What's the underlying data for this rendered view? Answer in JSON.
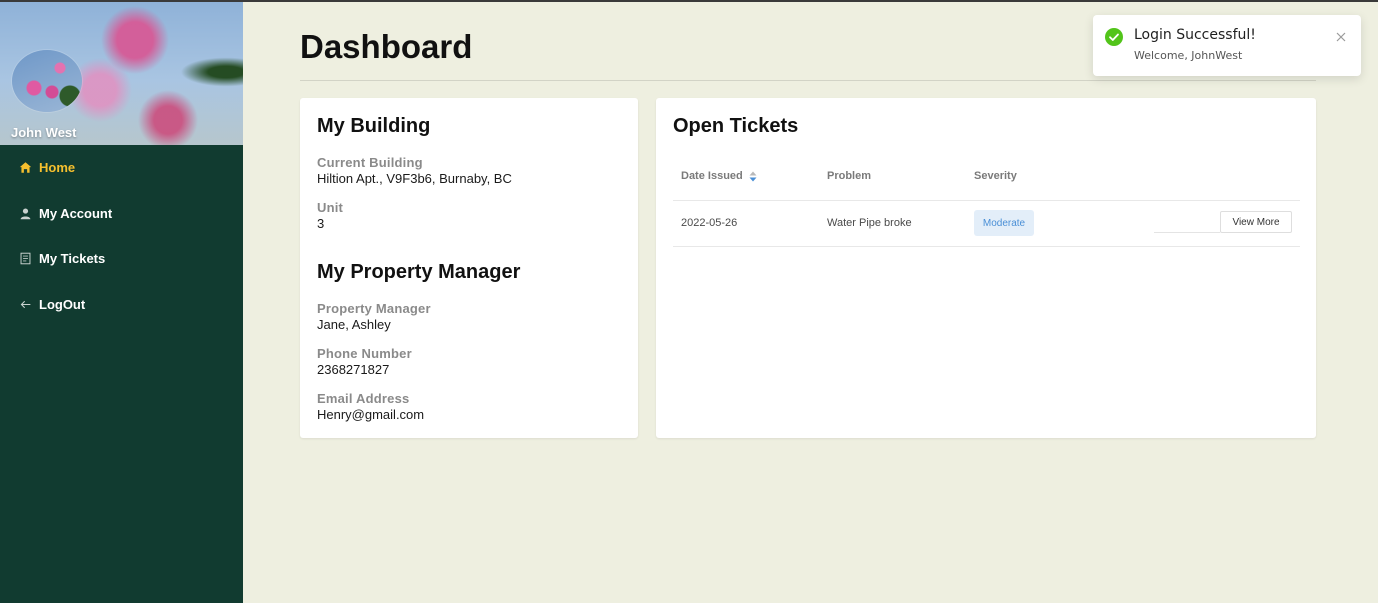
{
  "sidebar": {
    "user_name": "John West",
    "nav": [
      {
        "label": "Home",
        "icon": "home-icon",
        "active": true
      },
      {
        "label": "My Account",
        "icon": "user-icon",
        "active": false
      },
      {
        "label": "My Tickets",
        "icon": "document-icon",
        "active": false
      },
      {
        "label": "LogOut",
        "icon": "arrow-left-icon",
        "active": false
      }
    ]
  },
  "page": {
    "title": "Dashboard"
  },
  "building_card": {
    "title": "My Building",
    "current_building_label": "Current Building",
    "current_building_value": "Hiltion Apt., V9F3b6, Burnaby, BC",
    "unit_label": "Unit",
    "unit_value": "3",
    "manager_title": "My Property Manager",
    "manager_label": "Property Manager",
    "manager_value": "Jane, Ashley",
    "phone_label": "Phone Number",
    "phone_value": "2368271827",
    "email_label": "Email Address",
    "email_value": "Henry@gmail.com"
  },
  "tickets_card": {
    "title": "Open Tickets",
    "columns": [
      "Date Issued",
      "Problem",
      "Severity"
    ],
    "rows": [
      {
        "date": "2022-05-26",
        "problem": "Water Pipe broke",
        "severity": "Moderate",
        "action": "View More"
      }
    ]
  },
  "toast": {
    "title": "Login Successful!",
    "message": "Welcome, JohnWest"
  },
  "colors": {
    "sidebar_bg": "#113b30",
    "page_bg": "#eeefe0",
    "active_nav": "#f6c02e",
    "badge_bg": "#e3eef9",
    "badge_text": "#4a8fd6",
    "success": "#52c41a"
  }
}
